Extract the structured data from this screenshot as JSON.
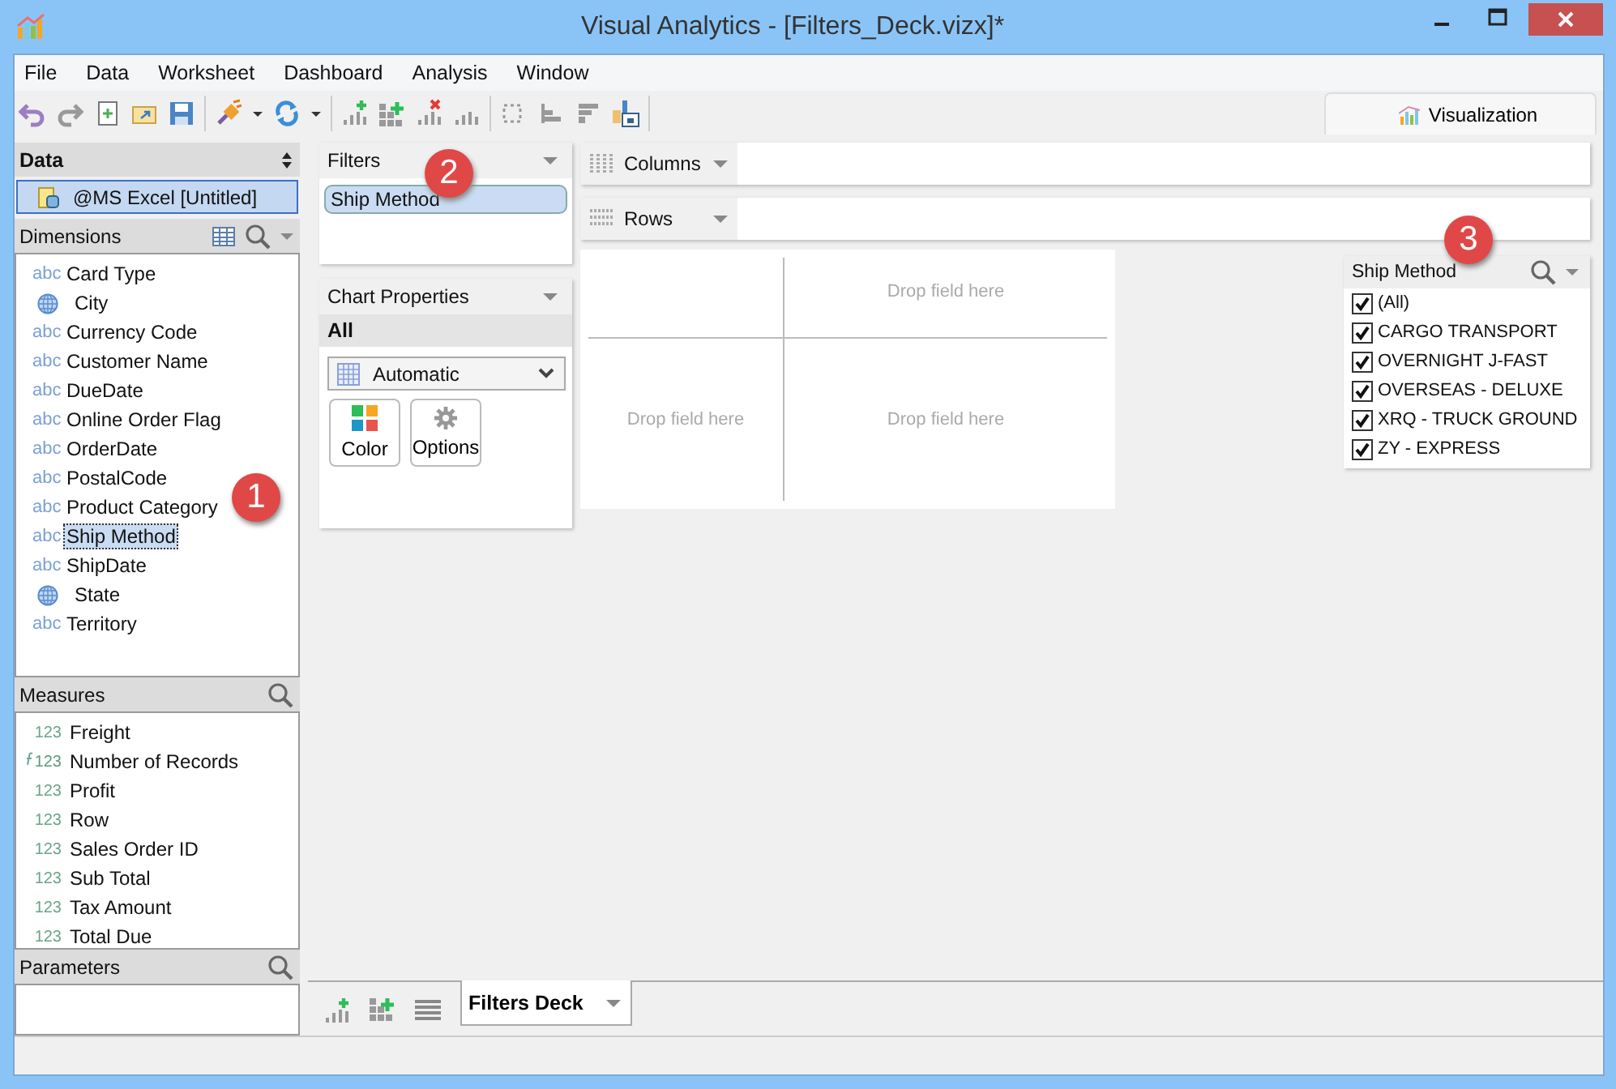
{
  "window": {
    "title": "Visual Analytics - [Filters_Deck.vizx]*"
  },
  "menu": [
    "File",
    "Data",
    "Worksheet",
    "Dashboard",
    "Analysis",
    "Window"
  ],
  "view_tab": {
    "label": "Visualization",
    "selected": true
  },
  "data_panel": {
    "title": "Data",
    "source": "@MS Excel [Untitled]"
  },
  "dimensions": {
    "title": "Dimensions",
    "items": [
      {
        "label": "Card Type",
        "kind": "text",
        "type_label": "abc",
        "selected": false
      },
      {
        "label": "City",
        "kind": "geo",
        "selected": false
      },
      {
        "label": "Currency Code",
        "kind": "text",
        "type_label": "abc",
        "selected": false
      },
      {
        "label": "Customer Name",
        "kind": "text",
        "type_label": "abc",
        "selected": false
      },
      {
        "label": "DueDate",
        "kind": "text",
        "type_label": "abc",
        "selected": false
      },
      {
        "label": "Online Order Flag",
        "kind": "text",
        "type_label": "abc",
        "selected": false
      },
      {
        "label": "OrderDate",
        "kind": "text",
        "type_label": "abc",
        "selected": false
      },
      {
        "label": "PostalCode",
        "kind": "text",
        "type_label": "abc",
        "selected": false
      },
      {
        "label": "Product Category",
        "kind": "text",
        "type_label": "abc",
        "selected": false
      },
      {
        "label": "Ship Method",
        "kind": "text",
        "type_label": "abc",
        "selected": true
      },
      {
        "label": "ShipDate",
        "kind": "text",
        "type_label": "abc",
        "selected": false
      },
      {
        "label": "State",
        "kind": "geo",
        "selected": false
      },
      {
        "label": "Territory",
        "kind": "text",
        "type_label": "abc",
        "selected": false
      }
    ]
  },
  "measures": {
    "title": "Measures",
    "items": [
      {
        "label": "Freight",
        "type_label": "123",
        "calculated": false
      },
      {
        "label": "Number of Records",
        "type_label": "123",
        "calculated": true
      },
      {
        "label": "Profit",
        "type_label": "123",
        "calculated": false
      },
      {
        "label": "Row",
        "type_label": "123",
        "calculated": false
      },
      {
        "label": "Sales Order ID",
        "type_label": "123",
        "calculated": false
      },
      {
        "label": "Sub Total",
        "type_label": "123",
        "calculated": false
      },
      {
        "label": "Tax Amount",
        "type_label": "123",
        "calculated": false
      },
      {
        "label": "Total Due",
        "type_label": "123",
        "calculated": false
      }
    ]
  },
  "parameters": {
    "title": "Parameters"
  },
  "filters": {
    "title": "Filters",
    "items": [
      "Ship Method"
    ]
  },
  "chart_properties": {
    "title": "Chart Properties",
    "section": "All",
    "mark_type": "Automatic",
    "buttons": [
      {
        "label": "Color",
        "kind": "color"
      },
      {
        "label": "Options",
        "kind": "options"
      }
    ]
  },
  "shelves": [
    {
      "label": "Columns",
      "kind": "columns"
    },
    {
      "label": "Rows",
      "kind": "rows"
    }
  ],
  "canvas": {
    "placeholders": [
      "Drop field here",
      "Drop field here",
      "Drop field here"
    ]
  },
  "filter_card": {
    "title": "Ship Method",
    "items": [
      {
        "label": "(All)",
        "checked": true
      },
      {
        "label": "CARGO TRANSPORT",
        "checked": true
      },
      {
        "label": "OVERNIGHT J-FAST",
        "checked": true
      },
      {
        "label": "OVERSEAS - DELUXE",
        "checked": true
      },
      {
        "label": "XRQ - TRUCK GROUND",
        "checked": true
      },
      {
        "label": "ZY - EXPRESS",
        "checked": true
      }
    ]
  },
  "sheet_tabs": [
    {
      "label": "Filters Deck",
      "selected": true
    }
  ],
  "callouts": [
    "1",
    "2",
    "3"
  ]
}
